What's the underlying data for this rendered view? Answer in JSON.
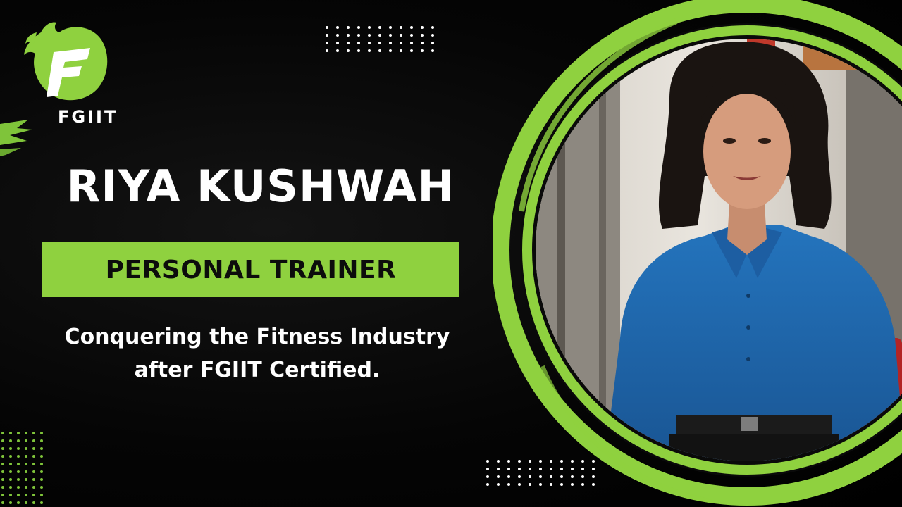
{
  "brand": {
    "logo_text": "FGIIT",
    "accent_color": "#8fd13f"
  },
  "hero": {
    "name": "RIYA KUSHWAH",
    "role": "PERSONAL TRAINER",
    "tagline_line1": "Conquering the Fitness Industry",
    "tagline_line2": "after FGIIT Certified."
  },
  "photo": {
    "subject": "woman-in-blue-shirt-portrait",
    "ring_color": "#8fd13f",
    "shirt_color": "#1f67ad"
  },
  "decor": {
    "dot_color": "#ffffff",
    "green_dot_color": "#7fc43a"
  }
}
